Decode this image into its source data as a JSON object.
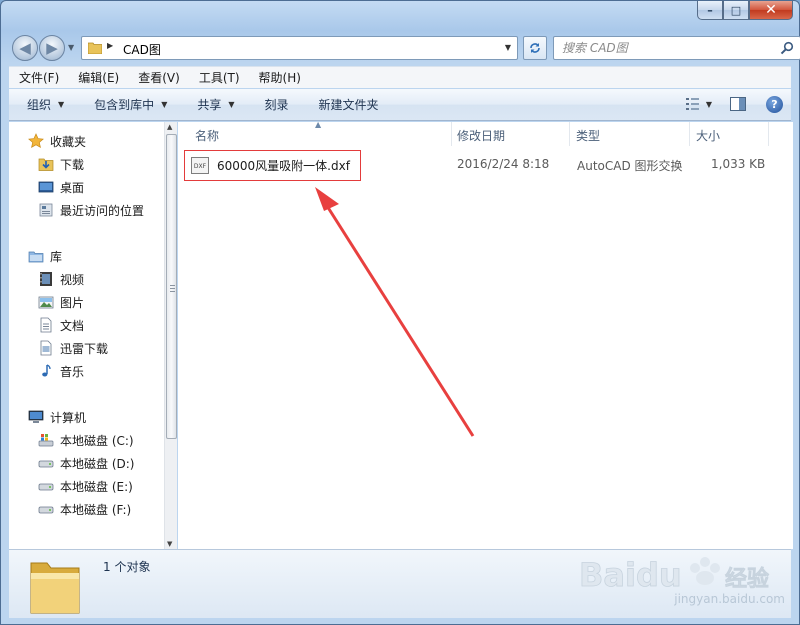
{
  "window": {
    "caption_minimize": "–",
    "caption_maximize": "□",
    "caption_close": "✕"
  },
  "address": {
    "path": "CAD图",
    "search_placeholder": "搜索 CAD图"
  },
  "menu": [
    "文件(F)",
    "编辑(E)",
    "查看(V)",
    "工具(T)",
    "帮助(H)"
  ],
  "toolbar": {
    "organize": "组织",
    "include_in_library": "包含到库中",
    "share": "共享",
    "burn": "刻录",
    "new_folder": "新建文件夹"
  },
  "navpane": {
    "favorites": "收藏夹",
    "downloads": "下载",
    "desktop": "桌面",
    "recent": "最近访问的位置",
    "libraries": "库",
    "videos": "视频",
    "pictures": "图片",
    "documents": "文档",
    "thunder": "迅雷下载",
    "music": "音乐",
    "computer": "计算机",
    "drive_c": "本地磁盘 (C:)",
    "drive_d": "本地磁盘 (D:)",
    "drive_e": "本地磁盘 (E:)",
    "drive_f": "本地磁盘 (F:)"
  },
  "columns": {
    "name": "名称",
    "modified": "修改日期",
    "type": "类型",
    "size": "大小"
  },
  "file": {
    "name": "60000风量吸附一体.dxf",
    "modified": "2016/2/24 8:18",
    "type": "AutoCAD 图形交换",
    "size": "1,033 KB",
    "icon_label": "DXF"
  },
  "status": {
    "count": "1 个对象"
  },
  "watermark": {
    "brand": "Baidu",
    "cn": "经验",
    "url": "jingyan.baidu.com"
  },
  "colors": {
    "highlight": "#e33b3b",
    "arrow": "#e8403f"
  }
}
